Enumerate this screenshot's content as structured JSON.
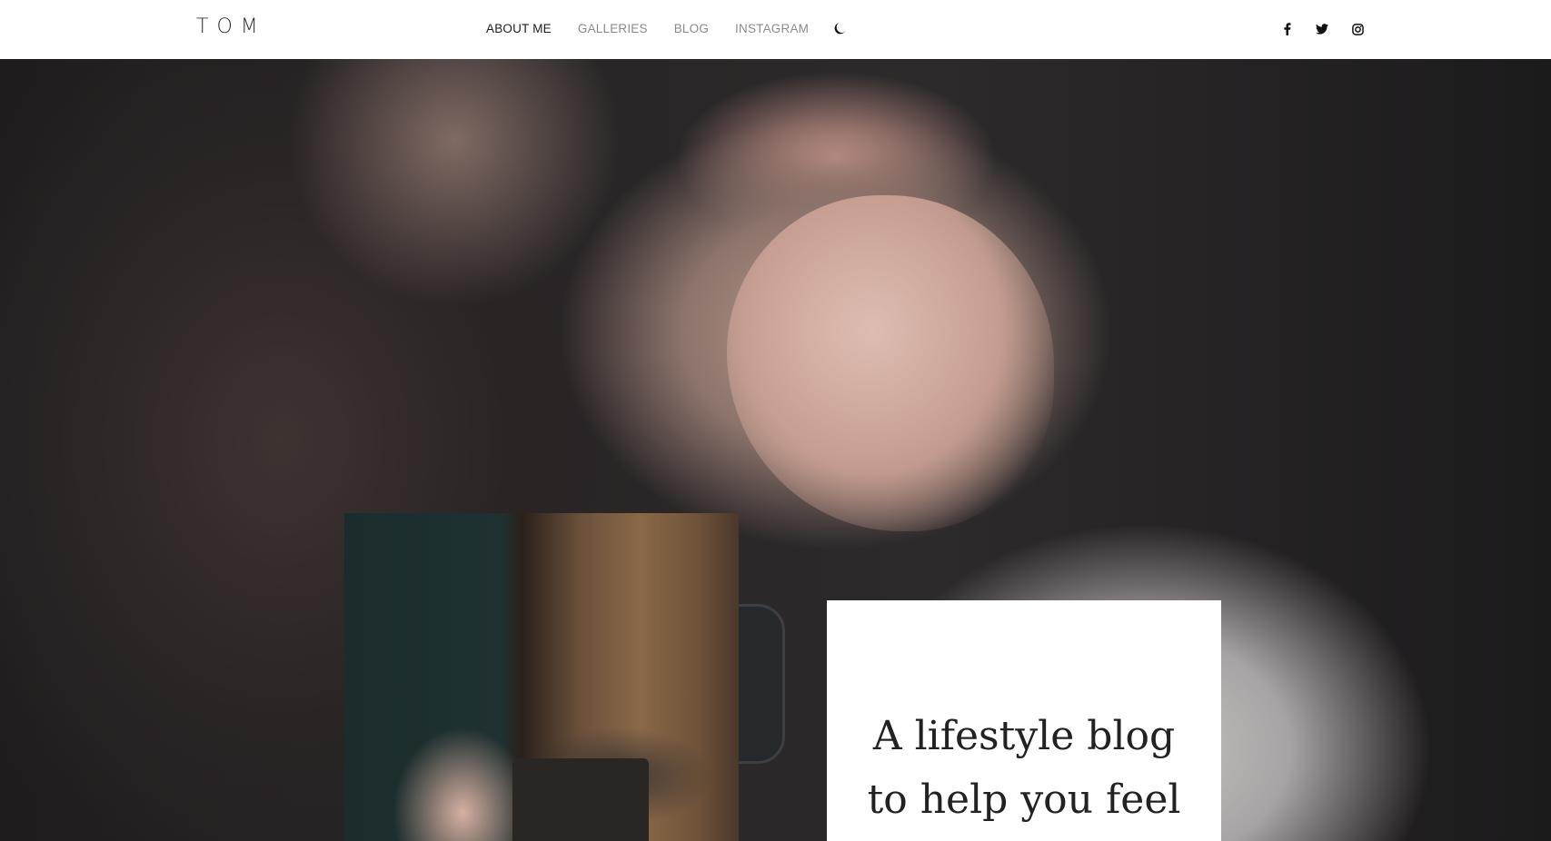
{
  "header": {
    "logo": "TOM",
    "nav": [
      {
        "label": "ABOUT ME",
        "active": true
      },
      {
        "label": "GALLERIES",
        "active": false
      },
      {
        "label": "BLOG",
        "active": false
      },
      {
        "label": "INSTAGRAM",
        "active": false
      }
    ],
    "theme_toggle_icon": "moon-icon",
    "social": [
      "facebook-icon",
      "twitter-icon",
      "instagram-icon"
    ]
  },
  "hero": {
    "headline_line1": "A lifestyle blog",
    "headline_line2": "to help you feel"
  },
  "colors": {
    "nav_active": "#1d1d1d",
    "nav_inactive": "#8a8a8a",
    "background": "#ffffff"
  }
}
